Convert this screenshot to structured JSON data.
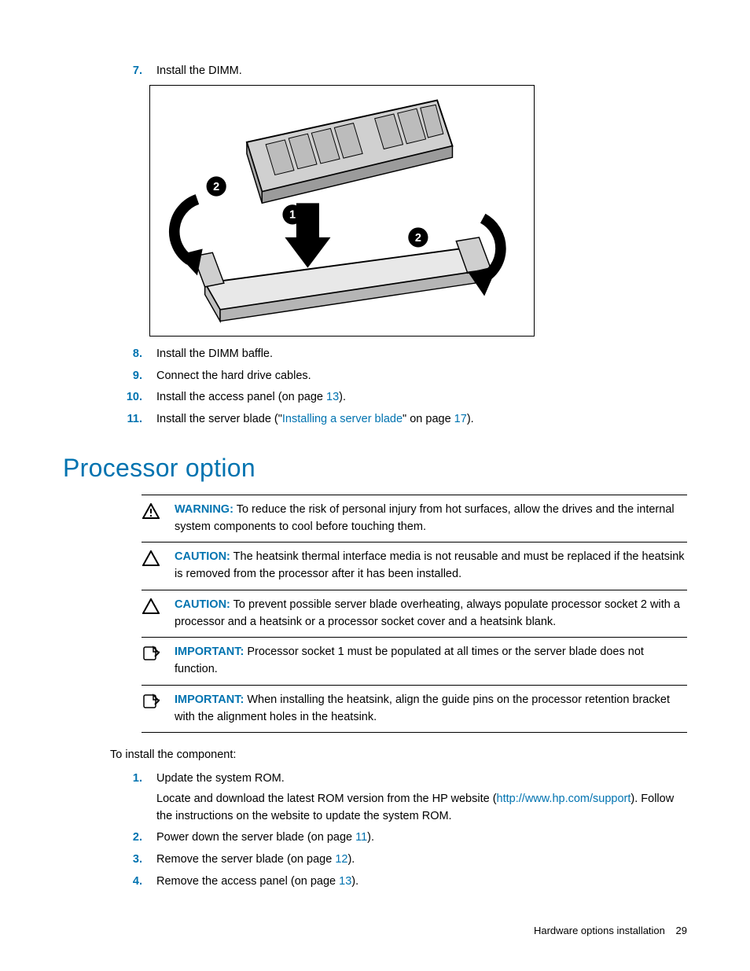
{
  "steps_a": [
    {
      "num": "7.",
      "text": "Install the DIMM."
    }
  ],
  "steps_b": [
    {
      "num": "8.",
      "text": "Install the DIMM baffle."
    },
    {
      "num": "9.",
      "text": "Connect the hard drive cables."
    },
    {
      "num": "10.",
      "pre": "Install the access panel (on page ",
      "link": "13",
      "post": ")."
    },
    {
      "num": "11.",
      "pre": "Install the server blade (\"",
      "link": "Installing a server blade",
      "mid": "\" on page ",
      "link2": "17",
      "post": ")."
    }
  ],
  "heading": "Processor option",
  "admonitions": [
    {
      "type": "warning",
      "label": "WARNING:",
      "text": "   To reduce the risk of personal injury from hot surfaces, allow the drives and the internal system components to cool before touching them."
    },
    {
      "type": "caution",
      "label": "CAUTION:",
      "text": "   The heatsink thermal interface media is not reusable and must be replaced if the heatsink is removed from the processor after it has been installed."
    },
    {
      "type": "caution",
      "label": "CAUTION:",
      "text": "   To prevent possible server blade overheating, always populate processor socket 2 with a processor and a heatsink or a processor socket cover and a heatsink blank."
    },
    {
      "type": "important",
      "label": "IMPORTANT:",
      "text": "   Processor socket 1 must be populated at all times or the server blade does not function."
    },
    {
      "type": "important",
      "label": "IMPORTANT:",
      "text": "   When installing the heatsink, align the guide pins on the processor retention bracket with the alignment holes in the heatsink."
    }
  ],
  "intro": "To install the component:",
  "steps_c": [
    {
      "num": "1.",
      "text": "Update the system ROM.",
      "sub_pre": "Locate and download the latest ROM version from the HP website (",
      "sub_link": "http://www.hp.com/support",
      "sub_post": "). Follow the instructions on the website to update the system ROM."
    },
    {
      "num": "2.",
      "pre": "Power down the server blade (on page ",
      "link": "11",
      "post": ")."
    },
    {
      "num": "3.",
      "pre": "Remove the server blade (on page ",
      "link": "12",
      "post": ")."
    },
    {
      "num": "4.",
      "pre": "Remove the access panel (on page ",
      "link": "13",
      "post": ")."
    }
  ],
  "footer": {
    "section": "Hardware options installation",
    "page": "29"
  },
  "callouts": {
    "one": "1",
    "two_a": "2",
    "two_b": "2"
  }
}
